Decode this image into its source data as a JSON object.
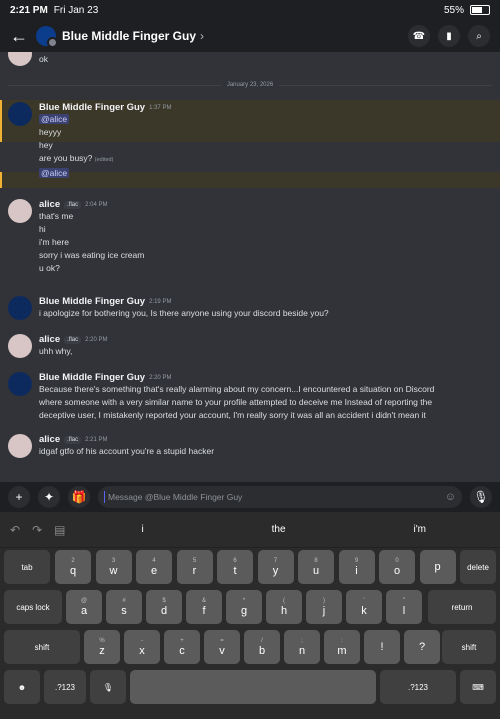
{
  "status": {
    "time": "2:21 PM",
    "date": "Fri Jan 23",
    "battery": "55%",
    "battery_level": 0.55
  },
  "header": {
    "title": "Blue Middle Finger Guy",
    "back_icon": "←",
    "call_icon": "☎",
    "video_icon": "▮",
    "search_icon": "⌕"
  },
  "chat": {
    "top": {
      "author": "alice",
      "text": "ok"
    },
    "date_separator": "January 23, 2026",
    "m1": {
      "author": "Blue Middle Finger Guy",
      "time": "1:37 PM",
      "lines": [
        "@alice",
        "heyyy",
        "hey",
        "are you busy?",
        "@alice"
      ],
      "edited": "(edited)"
    },
    "m2": {
      "author": "alice",
      "tag": ".flac",
      "time": "2:04 PM",
      "lines": [
        "that's me",
        "hi",
        "i'm here",
        "sorry i was eating ice cream",
        "u ok?"
      ]
    },
    "m3": {
      "author": "Blue Middle Finger Guy",
      "time": "2:19 PM",
      "lines": [
        "i apologize for bothering you, Is there anyone using your discord beside you?"
      ]
    },
    "m4": {
      "author": "alice",
      "tag": ".flac",
      "time": "2:20 PM",
      "lines": [
        "uhh why,"
      ]
    },
    "m5": {
      "author": "Blue Middle Finger Guy",
      "time": "2:20 PM",
      "lines": [
        "Because there's something that's really alarming about my concern...I encountered a situation on Discord",
        "where someone with a very similar name to your profile attempted to deceive me Instead of reporting the",
        "deceptive user, I mistakenly reported your account, I'm really sorry it was all an accident i didn't mean it"
      ]
    },
    "m6": {
      "author": "alice",
      "tag": ".flac",
      "time": "2:21 PM",
      "lines": [
        "idgaf gtfo of his account you're a stupid hacker"
      ]
    }
  },
  "input": {
    "placeholder": "Message @Blue Middle Finger Guy",
    "plus_icon": "+",
    "apps_icon": "✦",
    "gift_icon": "🎁",
    "emoji_icon": "☺",
    "mic_icon": "🎙"
  },
  "keyboard": {
    "suggestions": [
      "i",
      "the",
      "i'm"
    ],
    "undo_icon": "↶",
    "redo_icon": "↷",
    "paste_icon": "▤",
    "row1": [
      [
        "2",
        "q"
      ],
      [
        "3",
        "w"
      ],
      [
        "4",
        "e"
      ],
      [
        "5",
        "r"
      ],
      [
        "6",
        "t"
      ],
      [
        "7",
        "y"
      ],
      [
        "8",
        "u"
      ],
      [
        "9",
        "i"
      ],
      [
        "0",
        "o"
      ],
      [
        "",
        "p"
      ]
    ],
    "row2": [
      [
        "@",
        "a"
      ],
      [
        "#",
        "s"
      ],
      [
        "$",
        "d"
      ],
      [
        "&",
        "f"
      ],
      [
        "*",
        "g"
      ],
      [
        "(",
        "h"
      ],
      [
        ")",
        "j"
      ],
      [
        "'",
        "k"
      ],
      [
        "\"",
        "l"
      ]
    ],
    "row3": [
      [
        "%",
        "z"
      ],
      [
        "-",
        "x"
      ],
      [
        "+",
        "c"
      ],
      [
        "=",
        "v"
      ],
      [
        "/",
        "b"
      ],
      [
        ";",
        "n"
      ],
      [
        ":",
        "m"
      ],
      [
        "",
        "!"
      ],
      [
        "",
        "?"
      ]
    ],
    "tab": "tab",
    "delete": "delete",
    "caps": "caps lock",
    "return": "return",
    "shift": "shift",
    "num": ".?123",
    "emoji_key": "☻",
    "mic_key": "🎙",
    "kb_key": "⌨"
  }
}
